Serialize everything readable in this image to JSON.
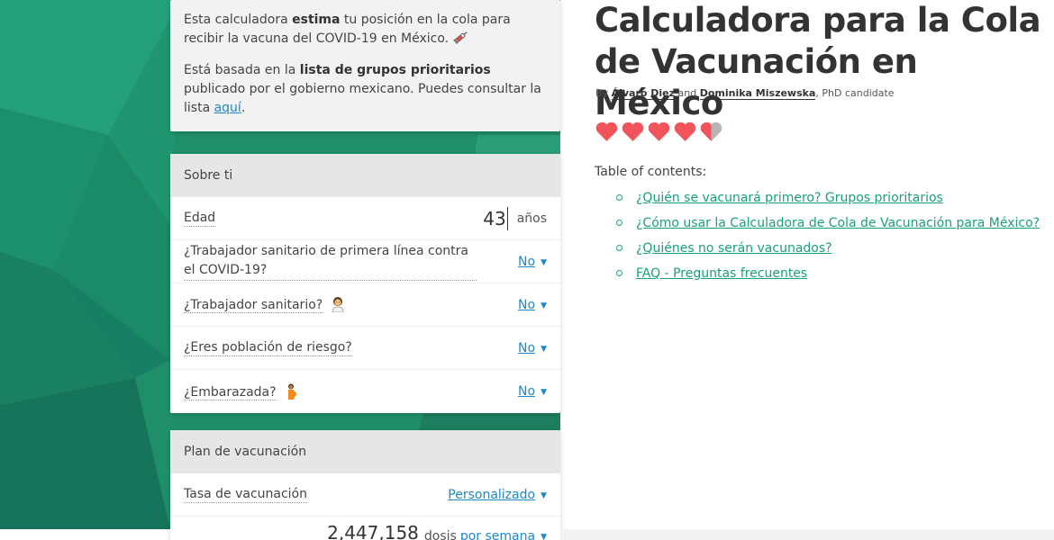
{
  "intro": {
    "p1_pre": "Esta calculadora ",
    "p1_bold": "estima",
    "p1_post": " tu posición en la cola para recibir la vacuna del COVID-19 en México.",
    "p2_pre": "Está basada en la ",
    "p2_bold": "lista de grupos prioritarios",
    "p2_post": " publicado por el gobierno mexicano. Puedes consultar la lista ",
    "p2_link": "aquí",
    "p2_end": "."
  },
  "about": {
    "heading": "Sobre ti",
    "age_label": "Edad",
    "age_value": "43",
    "age_unit": "años",
    "frontline_label": "¿Trabajador sanitario de primera línea contra el COVID-19?",
    "frontline_value": "No",
    "health_worker_label": "¿Trabajador sanitario?",
    "health_worker_value": "No",
    "risk_label": "¿Eres población de riesgo?",
    "risk_value": "No",
    "pregnant_label": "¿Embarazada?",
    "pregnant_value": "No"
  },
  "plan": {
    "heading": "Plan de vacunación",
    "rate_label": "Tasa de vacunación",
    "rate_value": "Personalizado",
    "doses_value": "2,447,158",
    "doses_unit": "dosis",
    "period_value": "por semana"
  },
  "article": {
    "title": "Calculadora para la Cola de Vacunación en México",
    "by": "By",
    "author1": "Álvaro Diez",
    "and": "and",
    "author2": "Dominika Miszewska",
    "suffix": ", PhD candidate",
    "rating": 4.5,
    "toc_label": "Table of contents:",
    "toc": [
      "¿Quién se vacunará primero? Grupos prioritarios",
      "¿Cómo usar la Calculadora de Cola de Vacunación para México?",
      "¿Quiénes no serán vacunados?",
      "FAQ - Preguntas frecuentes"
    ]
  },
  "colors": {
    "green_bg": "#1f8f6a",
    "link_blue": "#1e88c7",
    "toc_green": "#1aa07a",
    "heart_red": "#f2545b",
    "heart_gray": "#b5b5b5"
  }
}
